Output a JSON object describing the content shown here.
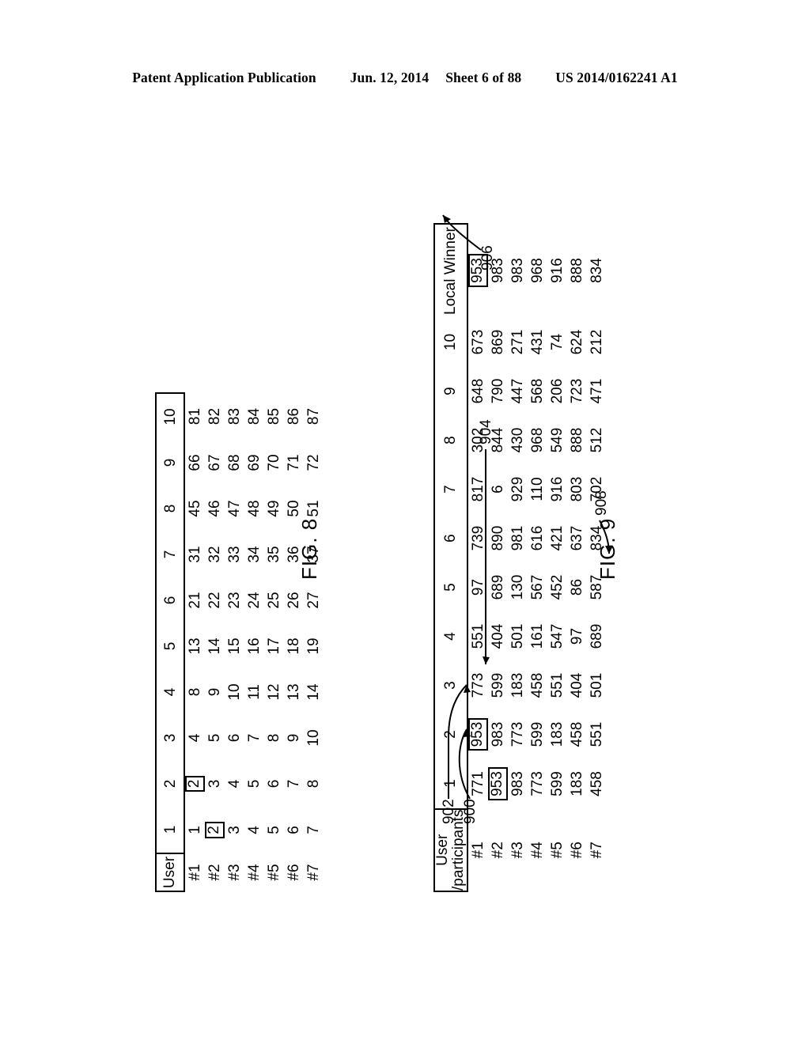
{
  "header": {
    "publication": "Patent Application Publication",
    "date": "Jun. 12, 2014",
    "sheet": "Sheet 6 of 88",
    "docnum": "US 2014/0162241 A1"
  },
  "fig8": {
    "label": "FIG. 8",
    "corner_header": "User",
    "columns": [
      "1",
      "2",
      "3",
      "4",
      "5",
      "6",
      "7",
      "8",
      "9",
      "10"
    ],
    "row_labels": [
      "#1",
      "#2",
      "#3",
      "#4",
      "#5",
      "#6",
      "#7"
    ],
    "rows": [
      [
        "1",
        "2",
        "4",
        "8",
        "13",
        "21",
        "31",
        "45",
        "66",
        "81"
      ],
      [
        "2",
        "3",
        "5",
        "9",
        "14",
        "22",
        "32",
        "46",
        "67",
        "82"
      ],
      [
        "3",
        "4",
        "6",
        "10",
        "15",
        "23",
        "33",
        "47",
        "68",
        "83"
      ],
      [
        "4",
        "5",
        "7",
        "11",
        "16",
        "24",
        "34",
        "48",
        "69",
        "84"
      ],
      [
        "5",
        "6",
        "8",
        "12",
        "17",
        "25",
        "35",
        "49",
        "70",
        "85"
      ],
      [
        "6",
        "7",
        "9",
        "13",
        "18",
        "26",
        "36",
        "50",
        "71",
        "86"
      ],
      [
        "7",
        "8",
        "10",
        "14",
        "19",
        "27",
        "37",
        "51",
        "72",
        "87"
      ]
    ],
    "boxed_cells": [
      [
        0,
        1
      ],
      [
        1,
        0
      ]
    ]
  },
  "fig9": {
    "label": "FIG. 9",
    "corner_header_line1": "User",
    "corner_header_line2": "/participants",
    "columns": [
      "1",
      "2",
      "3",
      "4",
      "5",
      "6",
      "7",
      "8",
      "9",
      "10"
    ],
    "local_winner_header": "Local Winner",
    "row_labels": [
      "#1",
      "#2",
      "#3",
      "#4",
      "#5",
      "#6",
      "#7"
    ],
    "rows": [
      [
        "771",
        "953",
        "773",
        "551",
        "97",
        "739",
        "817",
        "302",
        "648",
        "673"
      ],
      [
        "953",
        "983",
        "599",
        "404",
        "689",
        "890",
        "6",
        "844",
        "790",
        "869"
      ],
      [
        "983",
        "773",
        "183",
        "501",
        "130",
        "981",
        "929",
        "430",
        "447",
        "271"
      ],
      [
        "773",
        "599",
        "458",
        "161",
        "567",
        "616",
        "110",
        "968",
        "568",
        "431"
      ],
      [
        "599",
        "183",
        "551",
        "547",
        "452",
        "421",
        "916",
        "549",
        "206",
        "74"
      ],
      [
        "183",
        "458",
        "404",
        "97",
        "86",
        "637",
        "803",
        "888",
        "723",
        "624"
      ],
      [
        "458",
        "551",
        "501",
        "689",
        "587",
        "834",
        "702",
        "512",
        "471",
        "212"
      ]
    ],
    "local_winner": [
      "953",
      "983",
      "983",
      "968",
      "916",
      "888",
      "834"
    ],
    "boxed_cells": [
      [
        0,
        1
      ],
      [
        1,
        0
      ]
    ],
    "boxed_local_winner_rows": [
      0
    ],
    "ref_numerals": [
      {
        "id": "900",
        "label": "900"
      },
      {
        "id": "902",
        "label": "902"
      },
      {
        "id": "904",
        "label": "904"
      },
      {
        "id": "906",
        "label": "906"
      },
      {
        "id": "908",
        "label": "908"
      }
    ]
  }
}
